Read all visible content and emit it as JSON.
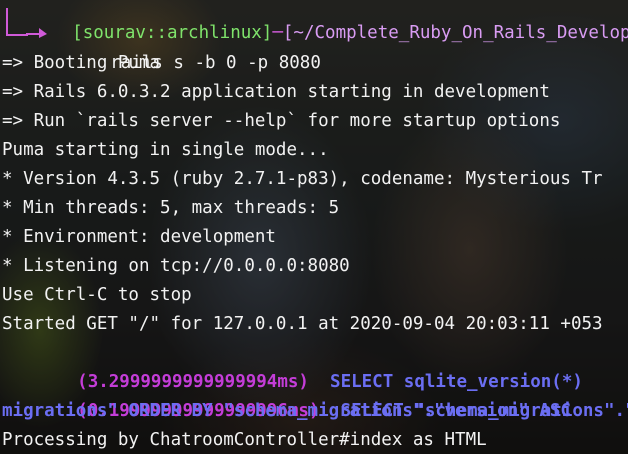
{
  "prompt": {
    "line1_prefix": "┌─",
    "user": "[sourav::archlinux]",
    "separator": "─",
    "path": "[~/Complete_Ruby_On_Rails_Develope",
    "command": "rails s -b 0 -p 8080"
  },
  "output": [
    "=> Booting Puma",
    "=> Rails 6.0.3.2 application starting in development",
    "=> Run `rails server --help` for more startup options",
    "Puma starting in single mode...",
    "* Version 4.3.5 (ruby 2.7.1-p83), codename: Mysterious Tr",
    "* Min threads: 5, max threads: 5",
    "* Environment: development",
    "* Listening on tcp://0.0.0.0:8080",
    "Use Ctrl-C to stop",
    "Started GET \"/\" for 127.0.0.1 at 2020-09-04 20:03:11 +053"
  ],
  "sql": [
    {
      "duration": "(3.2999999999999994ms)",
      "query": "SELECT sqlite_version(*)"
    },
    {
      "duration": "(0.19999999999999996ms)",
      "query": "SELECT \"schema_migrations\".\"v"
    }
  ],
  "sql_wrap": "migrations\" ORDER BY \"schema_migrations\".\"version\" ASC",
  "processing": "Processing by ChatroomController#index as HTML",
  "colors": {
    "prompt_user": "#7fe36b",
    "prompt_path": "#d99cf3",
    "prompt_frame": "#d05ad8",
    "sql_duration": "#c43dd8",
    "sql_query": "#6b6ef2",
    "text": "#f2f2f2"
  }
}
